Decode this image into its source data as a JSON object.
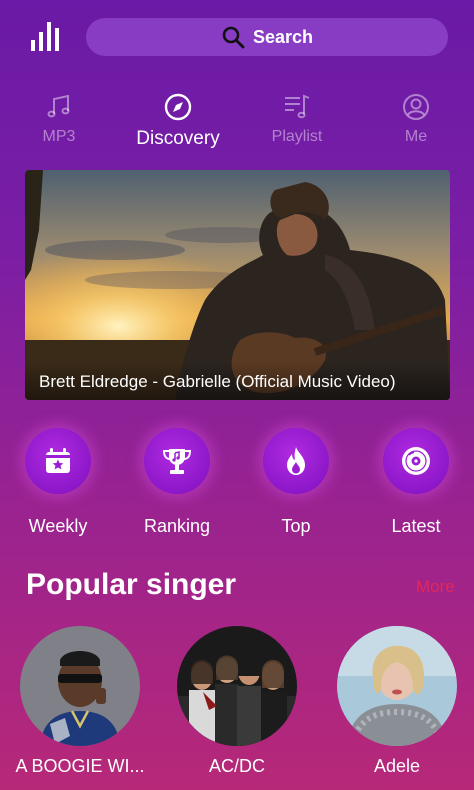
{
  "search": {
    "label": "Search"
  },
  "tabs": [
    {
      "label": "MP3",
      "icon": "music-note-icon",
      "active": false
    },
    {
      "label": "Discovery",
      "icon": "compass-icon",
      "active": true
    },
    {
      "label": "Playlist",
      "icon": "playlist-icon",
      "active": false
    },
    {
      "label": "Me",
      "icon": "user-icon",
      "active": false
    }
  ],
  "featured": {
    "title": "Brett Eldredge - Gabrielle (Official Music Video)"
  },
  "categories": [
    {
      "label": "Weekly",
      "icon": "calendar-star-icon"
    },
    {
      "label": "Ranking",
      "icon": "trophy-icon"
    },
    {
      "label": "Top",
      "icon": "flame-icon"
    },
    {
      "label": "Latest",
      "icon": "disc-icon"
    }
  ],
  "popular": {
    "title": "Popular singer",
    "more_label": "More",
    "singers": [
      {
        "name": "A BOOGIE WI..."
      },
      {
        "name": "AC/DC"
      },
      {
        "name": "Adele"
      }
    ]
  },
  "colors": {
    "accent": "#8d18c9",
    "more": "#e0285a",
    "bg_top": "#6a1aa6",
    "bg_bottom": "#b72878"
  }
}
